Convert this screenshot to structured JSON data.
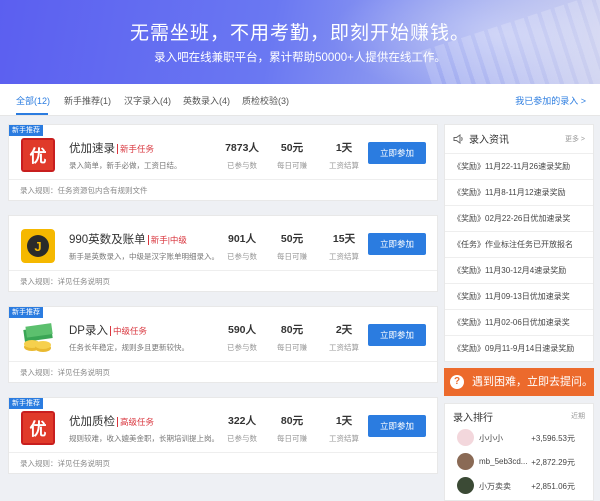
{
  "banner": {
    "title": "无需坐班，不用考勤，即刻开始赚钱。",
    "subtitle": "录入吧在线兼职平台，累计帮助50000+人提供在线工作。"
  },
  "tabs": [
    {
      "label": "全部(12)",
      "active": true
    },
    {
      "label": "新手推荐(1)"
    },
    {
      "label": "汉字录入(4)"
    },
    {
      "label": "英数录入(4)"
    },
    {
      "label": "质检校验(3)"
    }
  ],
  "tabs_right": "我已参加的录入 >",
  "stat_labels": {
    "participants": "已参与数",
    "daily": "每日可赚",
    "settle": "工资结算"
  },
  "join_label": "立即参加",
  "tasks": [
    {
      "badge": "新手推荐",
      "name": "优加速录",
      "tag": "新手任务",
      "desc": "录入简单，新手必做，工资日结。",
      "participants": "7873人",
      "daily": "50元",
      "settle": "1天",
      "rule": "录入规则：任务资源包内含有规则文件"
    },
    {
      "badge": "",
      "name": "990英数及账单",
      "tag": "新手|中级",
      "desc": "新手是英数录入，中级是汉字账单明细录入。",
      "participants": "901人",
      "daily": "50元",
      "settle": "15天",
      "rule": "录入规则：详见任务说明页"
    },
    {
      "badge": "新手推荐",
      "name": "DP录入",
      "tag": "中级任务",
      "desc": "任务长年稳定，规则多且更新较快。",
      "participants": "590人",
      "daily": "80元",
      "settle": "2天",
      "rule": "录入规则：详见任务说明页"
    },
    {
      "badge": "新手推荐",
      "name": "优加质检",
      "tag": "高级任务",
      "desc": "规则较难，收入媲美金职，长期培训提上岗。",
      "participants": "322人",
      "daily": "80元",
      "settle": "1天",
      "rule": "录入规则：详见任务说明页"
    }
  ],
  "news": {
    "title": "录入资讯",
    "more": "更多 >",
    "items": [
      "《奖励》11月22-11月26速录奖励",
      "《奖励》11月8-11月12速录奖励",
      "《奖励》02月22-26日优加速录奖",
      "《任务》作业标注任务已开放报名",
      "《奖励》11月30-12月4速录奖励",
      "《奖励》11月09-13日优加速录奖",
      "《奖励》11月02-06日优加速录奖",
      "《奖励》09月11-9月14日速录奖励"
    ]
  },
  "help": {
    "label": "遇到困难，立即去提问。",
    "icon": "?"
  },
  "ranking": {
    "title": "录入排行",
    "recent": "近期",
    "rows": [
      {
        "name": "小小小",
        "amount": "+3,596.53元"
      },
      {
        "name": "mb_5eb3cd...",
        "amount": "+2,872.29元"
      },
      {
        "name": "小万卖卖",
        "amount": "+2,851.06元"
      }
    ]
  },
  "colors": {
    "accent": "#2b7ce0",
    "help": "#ec6a2c",
    "tag": "#d9363e"
  }
}
